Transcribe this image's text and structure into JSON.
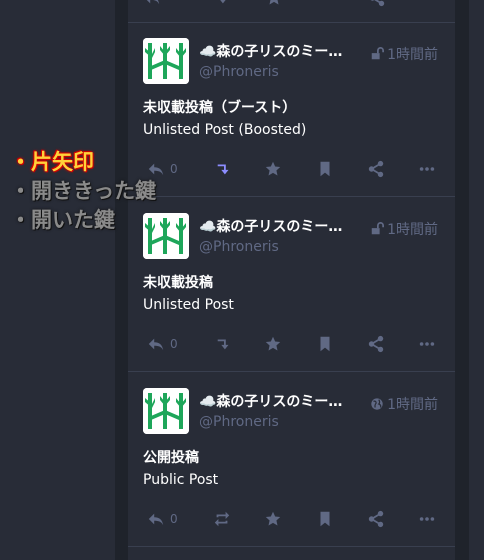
{
  "statuses": [
    {
      "display_name": "☁️森の子リスのミー…",
      "handle": "@Phroneris",
      "time": "1時間前",
      "visibility_icon": "unlock-icon",
      "content_line1": "未収載投稿（ブースト）",
      "content_line2": "Unlisted Post (Boosted)",
      "reply_count": "0",
      "boosted": true
    },
    {
      "display_name": "☁️森の子リスのミー…",
      "handle": "@Phroneris",
      "time": "1時間前",
      "visibility_icon": "unlock-icon",
      "content_line1": "未収載投稿",
      "content_line2": "Unlisted Post",
      "reply_count": "0",
      "boosted": false
    },
    {
      "display_name": "☁️森の子リスのミー…",
      "handle": "@Phroneris",
      "time": "1時間前",
      "visibility_icon": "globe-icon",
      "content_line1": "公開投稿",
      "content_line2": "Public Post",
      "reply_count": "0",
      "boosted": false
    }
  ],
  "legend": {
    "item1": "・片矢印",
    "item2": "・開ききった鍵",
    "item3": "・開いた鍵"
  },
  "colors": {
    "background": "#282c37",
    "muted": "#606984",
    "boost_active": "#8c8dff",
    "legend_active": "#ffd23a",
    "legend_outline": "#d10000"
  }
}
